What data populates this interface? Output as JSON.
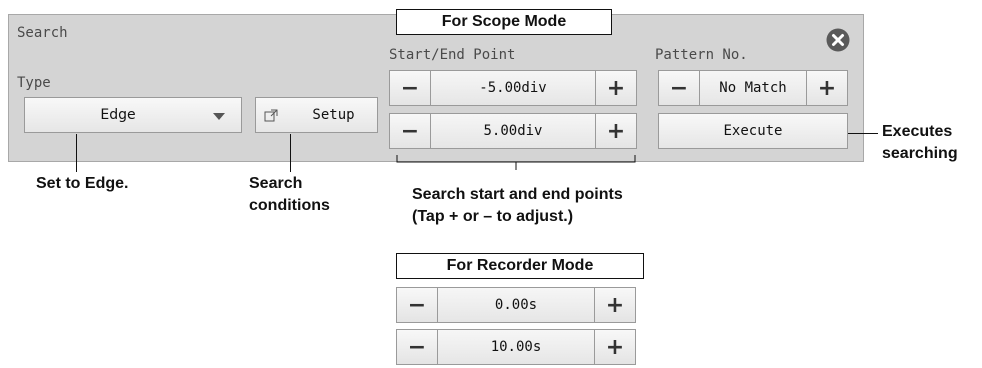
{
  "panel": {
    "title": "Search",
    "type_label": "Type",
    "type_value": "Edge",
    "setup_label": "Setup",
    "start_end_label": "Start/End Point",
    "start_value": "-5.00div",
    "end_value": "5.00div",
    "pattern_label": "Pattern No.",
    "pattern_value": "No Match",
    "execute_label": "Execute",
    "minus_symbol": "−",
    "plus_symbol": "+"
  },
  "modes": {
    "scope_title": "For Scope Mode",
    "recorder_title": "For Recorder Mode",
    "recorder_start_value": "0.00s",
    "recorder_end_value": "10.00s"
  },
  "annotations": {
    "type": "Set to Edge.",
    "setup_line1": "Search",
    "setup_line2": "conditions",
    "points_line1": "Search start and end points",
    "points_line2": "(Tap + or – to adjust.)",
    "execute_line1": "Executes",
    "execute_line2": "searching"
  },
  "colors": {
    "panel_bg": "#d4d4d4",
    "close_icon_bg": "#5a5a5a"
  }
}
